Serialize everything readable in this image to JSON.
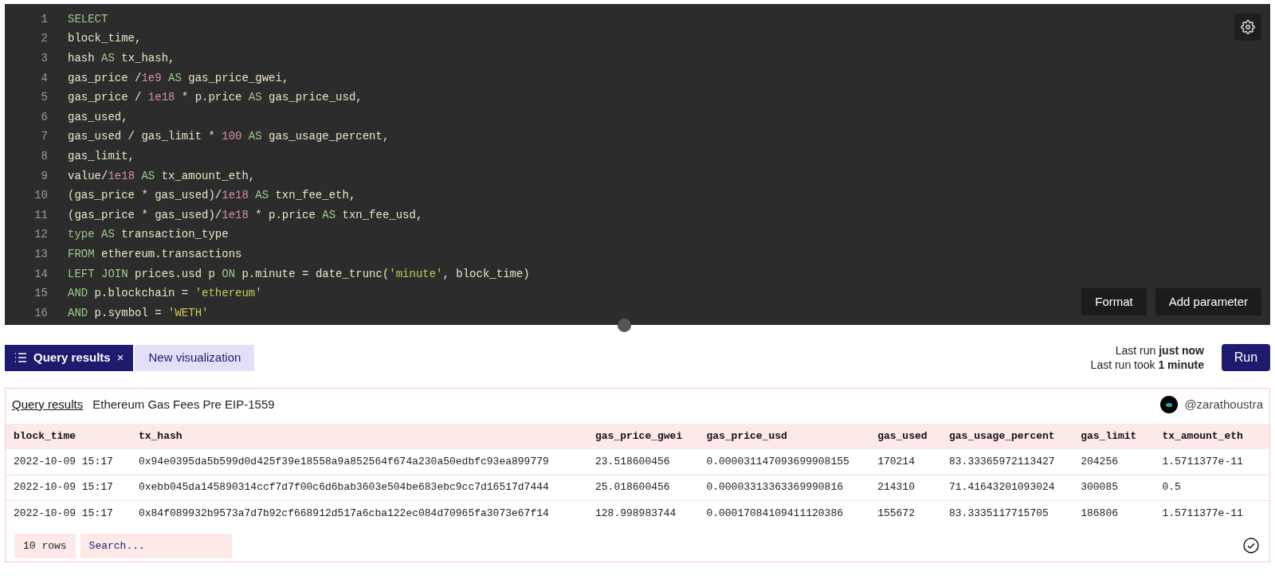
{
  "editor": {
    "lines": [
      [
        {
          "text": "SELECT",
          "kind": "keyword"
        }
      ],
      [
        {
          "text": "block_time,",
          "kind": "plain"
        }
      ],
      [
        {
          "text": "hash ",
          "kind": "plain"
        },
        {
          "text": "AS",
          "kind": "keyword"
        },
        {
          "text": " tx_hash,",
          "kind": "plain"
        }
      ],
      [
        {
          "text": "gas_price /",
          "kind": "plain"
        },
        {
          "text": "1e9",
          "kind": "number"
        },
        {
          "text": " AS",
          "kind": "keyword"
        },
        {
          "text": " gas_price_gwei,",
          "kind": "plain"
        }
      ],
      [
        {
          "text": "gas_price / ",
          "kind": "plain"
        },
        {
          "text": "1e18",
          "kind": "number"
        },
        {
          "text": " * p.price ",
          "kind": "plain"
        },
        {
          "text": "AS",
          "kind": "keyword"
        },
        {
          "text": " gas_price_usd,",
          "kind": "plain"
        }
      ],
      [
        {
          "text": "gas_used,",
          "kind": "plain"
        }
      ],
      [
        {
          "text": "gas_used / gas_limit * ",
          "kind": "plain"
        },
        {
          "text": "100",
          "kind": "number"
        },
        {
          "text": " AS",
          "kind": "keyword"
        },
        {
          "text": " gas_usage_percent,",
          "kind": "plain"
        }
      ],
      [
        {
          "text": "gas_limit,",
          "kind": "plain"
        }
      ],
      [
        {
          "text": "value/",
          "kind": "plain"
        },
        {
          "text": "1e18",
          "kind": "number"
        },
        {
          "text": " AS",
          "kind": "keyword"
        },
        {
          "text": " tx_amount_eth,",
          "kind": "plain"
        }
      ],
      [
        {
          "text": "(gas_price * gas_used)/",
          "kind": "plain"
        },
        {
          "text": "1e18",
          "kind": "number"
        },
        {
          "text": " AS",
          "kind": "keyword"
        },
        {
          "text": " txn_fee_eth,",
          "kind": "plain"
        }
      ],
      [
        {
          "text": "(gas_price * gas_used)/",
          "kind": "plain"
        },
        {
          "text": "1e18",
          "kind": "number"
        },
        {
          "text": " * p.price ",
          "kind": "plain"
        },
        {
          "text": "AS",
          "kind": "keyword"
        },
        {
          "text": " txn_fee_usd,",
          "kind": "plain"
        }
      ],
      [
        {
          "text": "type AS",
          "kind": "keyword"
        },
        {
          "text": " transaction_type",
          "kind": "plain"
        }
      ],
      [
        {
          "text": "FROM",
          "kind": "keyword"
        },
        {
          "text": " ethereum.transactions",
          "kind": "plain"
        }
      ],
      [
        {
          "text": "LEFT JOIN",
          "kind": "keyword"
        },
        {
          "text": " prices.usd p ",
          "kind": "plain"
        },
        {
          "text": "ON",
          "kind": "keyword"
        },
        {
          "text": " p.minute = date_trunc(",
          "kind": "plain"
        },
        {
          "text": "'minute'",
          "kind": "string"
        },
        {
          "text": ", block_time)",
          "kind": "plain"
        }
      ],
      [
        {
          "text": "AND",
          "kind": "keyword"
        },
        {
          "text": " p.blockchain = ",
          "kind": "plain"
        },
        {
          "text": "'ethereum'",
          "kind": "string"
        }
      ],
      [
        {
          "text": "AND",
          "kind": "keyword"
        },
        {
          "text": " p.symbol = ",
          "kind": "plain"
        },
        {
          "text": "'WETH'",
          "kind": "string"
        }
      ]
    ],
    "line_numbers": [
      "1",
      "2",
      "3",
      "4",
      "5",
      "6",
      "7",
      "8",
      "9",
      "10",
      "11",
      "12",
      "13",
      "14",
      "15",
      "16"
    ],
    "buttons": [
      "Format",
      "Add parameter"
    ]
  },
  "tabs": [
    {
      "label": "Query results",
      "selected": true,
      "close": "×"
    },
    {
      "label": "New visualization",
      "selected": false
    }
  ],
  "run_status": [
    "Last run **just now**",
    "Last run took **1 minute**"
  ],
  "run_button": "Run",
  "results": {
    "link": "Query results",
    "title": "Ethereum Gas Fees Pre EIP-1559",
    "user": "@zarathoustra",
    "columns": [
      "block_time",
      "tx_hash",
      "gas_price_gwei",
      "gas_price_usd",
      "gas_used",
      "gas_usage_percent",
      "gas_limit",
      "tx_amount_eth"
    ],
    "rows": [
      [
        "2022-10-09 15:17",
        "0x94e0395da5b599d0d425f39e18558a9a852564f674a230a50edbfc93ea899779",
        "23.518600456",
        "0.000031147093699908155",
        "170214",
        "83.33365972113427",
        "204256",
        "1.5711377e-11"
      ],
      [
        "2022-10-09 15:17",
        "0xebb045da145890314ccf7d7f00c6d6bab3603e504be683ebc9cc7d16517d7444",
        "25.018600456",
        "0.00003313363369990816",
        "214310",
        "71.41643201093024",
        "300085",
        "0.5"
      ],
      [
        "2022-10-09 15:17",
        "0x84f089932b9573a7d7b92cf668912d517a6cba122ec084d70965fa3073e67f14",
        "128.998983744",
        "0.00017084109411120386",
        "155672",
        "83.3335117715705",
        "186806",
        "1.5711377e-11"
      ]
    ],
    "row_count": "10 rows",
    "search": {
      "placeholder": "Search..."
    }
  }
}
